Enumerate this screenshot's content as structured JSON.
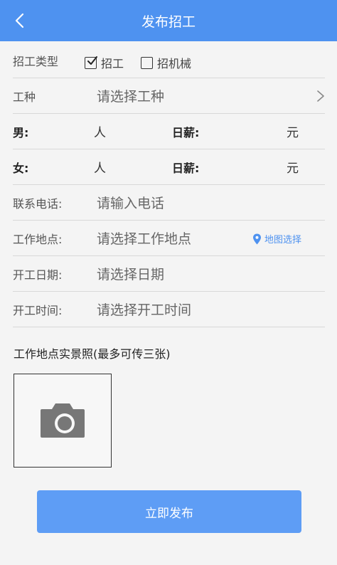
{
  "header": {
    "title": "发布招工",
    "back_icon": "chevron-left-icon"
  },
  "recruit_type": {
    "label": "招工类型",
    "options": [
      {
        "label": "招工",
        "checked": true
      },
      {
        "label": "招机械",
        "checked": false
      }
    ]
  },
  "job_type": {
    "label": "工种",
    "placeholder": "请选择工种",
    "chevron_icon": "chevron-right-icon"
  },
  "male": {
    "label": "男:",
    "unit": "人",
    "wage_label": "日薪:",
    "wage_unit": "元"
  },
  "female": {
    "label": "女:",
    "unit": "人",
    "wage_label": "日薪:",
    "wage_unit": "元"
  },
  "phone": {
    "label": "联系电话:",
    "placeholder": "请输入电话"
  },
  "location": {
    "label": "工作地点:",
    "placeholder": "请选择工作地点",
    "map_label": "地图选择",
    "map_icon": "location-pin-icon"
  },
  "start_date": {
    "label": "开工日期:",
    "placeholder": "请选择日期"
  },
  "start_time": {
    "label": "开工时间:",
    "placeholder": "请选择开工时间"
  },
  "photos": {
    "title": "工作地点实景照(最多可传三张)",
    "icon": "camera-icon"
  },
  "submit": {
    "label": "立即发布"
  },
  "colors": {
    "accent": "#4e92f0",
    "button": "#5e9df5"
  }
}
